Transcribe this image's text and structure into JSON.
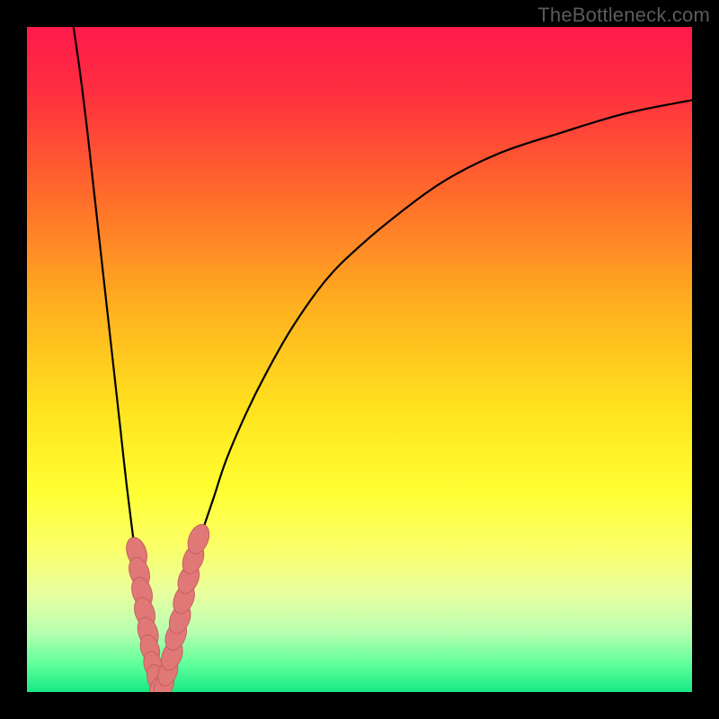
{
  "watermark": {
    "text": "TheBottleneck.com"
  },
  "colors": {
    "frame": "#000000",
    "curve": "#000000",
    "marker_fill": "#e07878",
    "marker_stroke": "#c85e5e",
    "gradient_stops": [
      {
        "offset": 0.0,
        "color": "#ff1a4c"
      },
      {
        "offset": 0.1,
        "color": "#ff2f3f"
      },
      {
        "offset": 0.25,
        "color": "#ff6a2b"
      },
      {
        "offset": 0.42,
        "color": "#ffb01f"
      },
      {
        "offset": 0.58,
        "color": "#ffe41e"
      },
      {
        "offset": 0.7,
        "color": "#ffff33"
      },
      {
        "offset": 0.78,
        "color": "#fbff66"
      },
      {
        "offset": 0.85,
        "color": "#e9ff9e"
      },
      {
        "offset": 0.91,
        "color": "#b8ffb0"
      },
      {
        "offset": 0.96,
        "color": "#5cff9a"
      },
      {
        "offset": 1.0,
        "color": "#17e884"
      }
    ]
  },
  "chart_data": {
    "type": "line",
    "title": "",
    "xlabel": "",
    "ylabel": "",
    "xlim": [
      0,
      100
    ],
    "ylim": [
      0,
      100
    ],
    "grid": false,
    "legend": false,
    "notch_x": 20,
    "series": [
      {
        "name": "left-branch",
        "x": [
          7,
          8,
          9,
          10,
          11,
          12,
          13,
          14,
          15,
          16,
          17,
          18,
          19,
          20
        ],
        "y": [
          100,
          93,
          85,
          76,
          67,
          58,
          49,
          40,
          31,
          23,
          15,
          9,
          4,
          0
        ]
      },
      {
        "name": "right-branch",
        "x": [
          20,
          21,
          22,
          23,
          24,
          26,
          28,
          30,
          33,
          36,
          40,
          45,
          50,
          56,
          63,
          71,
          80,
          90,
          100
        ],
        "y": [
          0,
          4,
          8,
          12,
          16,
          23,
          29,
          35,
          42,
          48,
          55,
          62,
          67,
          72,
          77,
          81,
          84,
          87,
          89
        ]
      }
    ],
    "markers": [
      {
        "x": 16.5,
        "y": 21,
        "r": 1.6
      },
      {
        "x": 16.9,
        "y": 18,
        "r": 1.6
      },
      {
        "x": 17.3,
        "y": 15,
        "r": 1.6
      },
      {
        "x": 17.7,
        "y": 12,
        "r": 1.6
      },
      {
        "x": 18.2,
        "y": 9,
        "r": 1.6
      },
      {
        "x": 18.5,
        "y": 6.5,
        "r": 1.5
      },
      {
        "x": 19.0,
        "y": 4,
        "r": 1.5
      },
      {
        "x": 19.5,
        "y": 2,
        "r": 1.5
      },
      {
        "x": 20.0,
        "y": 0.5,
        "r": 1.6
      },
      {
        "x": 20.6,
        "y": 1,
        "r": 1.5
      },
      {
        "x": 21.2,
        "y": 3,
        "r": 1.5
      },
      {
        "x": 21.8,
        "y": 5.5,
        "r": 1.6
      },
      {
        "x": 22.4,
        "y": 8.5,
        "r": 1.6
      },
      {
        "x": 23.0,
        "y": 11,
        "r": 1.6
      },
      {
        "x": 23.6,
        "y": 14,
        "r": 1.6
      },
      {
        "x": 24.3,
        "y": 17,
        "r": 1.6
      },
      {
        "x": 25.0,
        "y": 20,
        "r": 1.6
      },
      {
        "x": 25.8,
        "y": 23,
        "r": 1.6
      }
    ]
  }
}
